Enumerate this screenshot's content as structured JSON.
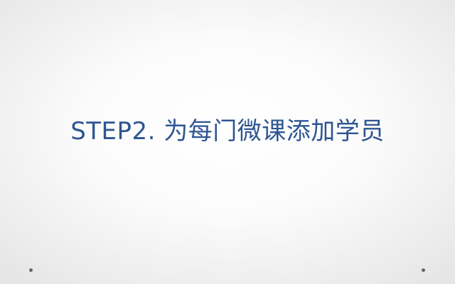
{
  "slide": {
    "title": "STEP2. 为每门微课添加学员"
  },
  "colors": {
    "title_text": "#2e5592",
    "background_center": "#ffffff",
    "background_edge": "#e6e6e6",
    "dot": "#666666"
  }
}
